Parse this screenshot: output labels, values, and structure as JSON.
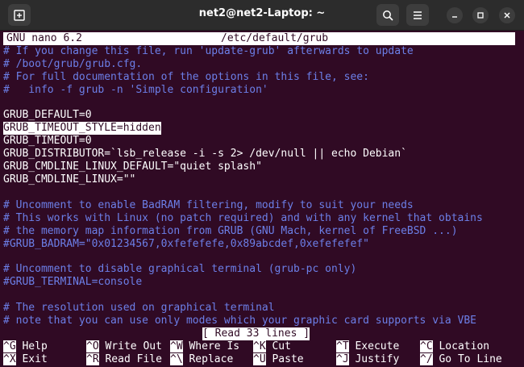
{
  "window": {
    "title": "net2@net2-Laptop: ~"
  },
  "nano": {
    "version_label": "GNU nano 6.2",
    "filename": "/etc/default/grub",
    "status": "[ Read 33 lines ]"
  },
  "lines": [
    {
      "type": "comment",
      "text": "# If you change this file, run 'update-grub' afterwards to update"
    },
    {
      "type": "comment",
      "text": "# /boot/grub/grub.cfg."
    },
    {
      "type": "comment",
      "text": "# For full documentation of the options in this file, see:"
    },
    {
      "type": "comment",
      "text": "#   info -f grub -n 'Simple configuration'"
    },
    {
      "type": "blank",
      "text": ""
    },
    {
      "type": "normal",
      "text": "GRUB_DEFAULT=0"
    },
    {
      "type": "highlight",
      "text": "GRUB_TIMEOUT_STYLE=hidden"
    },
    {
      "type": "normal",
      "text": "GRUB_TIMEOUT=0"
    },
    {
      "type": "normal",
      "text": "GRUB_DISTRIBUTOR=`lsb_release -i -s 2> /dev/null || echo Debian`"
    },
    {
      "type": "normal",
      "text": "GRUB_CMDLINE_LINUX_DEFAULT=\"quiet splash\""
    },
    {
      "type": "normal",
      "text": "GRUB_CMDLINE_LINUX=\"\""
    },
    {
      "type": "blank",
      "text": ""
    },
    {
      "type": "comment",
      "text": "# Uncomment to enable BadRAM filtering, modify to suit your needs"
    },
    {
      "type": "comment",
      "text": "# This works with Linux (no patch required) and with any kernel that obtains"
    },
    {
      "type": "comment",
      "text": "# the memory map information from GRUB (GNU Mach, kernel of FreeBSD ...)"
    },
    {
      "type": "comment",
      "text": "#GRUB_BADRAM=\"0x01234567,0xfefefefe,0x89abcdef,0xefefefef\""
    },
    {
      "type": "blank",
      "text": ""
    },
    {
      "type": "comment",
      "text": "# Uncomment to disable graphical terminal (grub-pc only)"
    },
    {
      "type": "comment",
      "text": "#GRUB_TERMINAL=console"
    },
    {
      "type": "blank",
      "text": ""
    },
    {
      "type": "comment",
      "text": "# The resolution used on graphical terminal"
    },
    {
      "type": "comment",
      "text": "# note that you can use only modes which your graphic card supports via VBE"
    }
  ],
  "shortcuts": [
    {
      "key": "^G",
      "label": "Help"
    },
    {
      "key": "^X",
      "label": "Exit"
    },
    {
      "key": "^O",
      "label": "Write Out"
    },
    {
      "key": "^R",
      "label": "Read File"
    },
    {
      "key": "^W",
      "label": "Where Is"
    },
    {
      "key": "^\\",
      "label": "Replace"
    },
    {
      "key": "^K",
      "label": "Cut"
    },
    {
      "key": "^U",
      "label": "Paste"
    },
    {
      "key": "^T",
      "label": "Execute"
    },
    {
      "key": "^J",
      "label": "Justify"
    },
    {
      "key": "^C",
      "label": "Location"
    },
    {
      "key": "^/",
      "label": "Go To Line"
    }
  ]
}
